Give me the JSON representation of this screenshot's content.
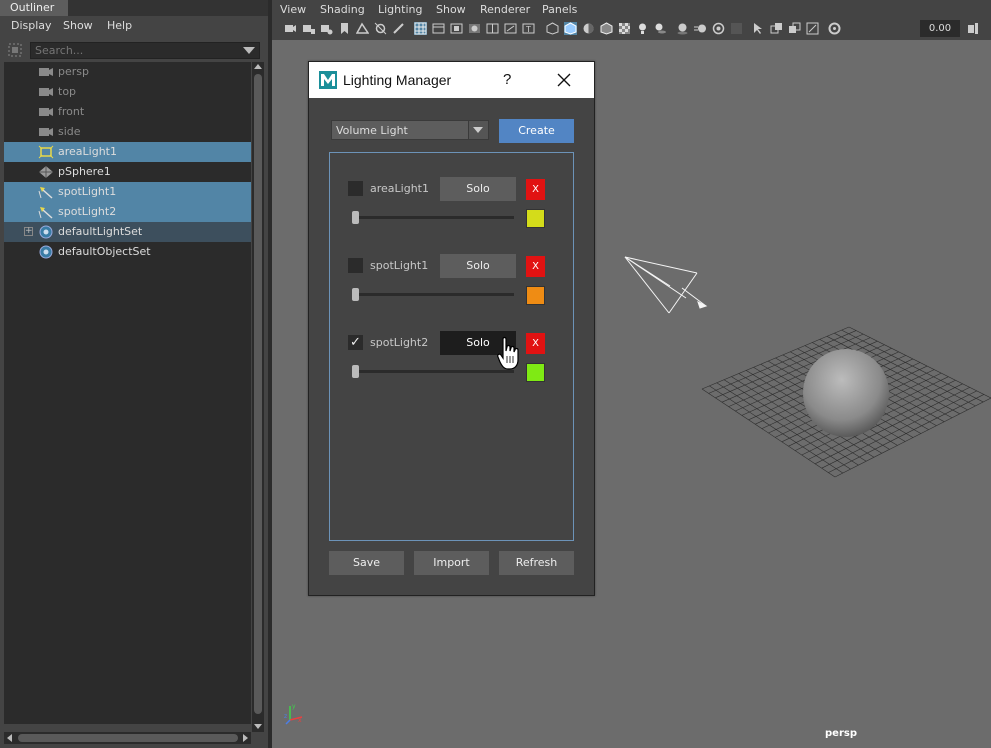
{
  "outliner": {
    "tab_label": "Outliner",
    "menu": [
      "Display",
      "Show",
      "Help"
    ],
    "search_placeholder": "Search...",
    "items": [
      {
        "label": "persp",
        "icon": "camera-icon",
        "state": "dim"
      },
      {
        "label": "top",
        "icon": "camera-icon",
        "state": "dim"
      },
      {
        "label": "front",
        "icon": "camera-icon",
        "state": "dim"
      },
      {
        "label": "side",
        "icon": "camera-icon",
        "state": "dim"
      },
      {
        "label": "areaLight1",
        "icon": "area-light-icon",
        "state": "selected"
      },
      {
        "label": "pSphere1",
        "icon": "mesh-icon",
        "state": "normal"
      },
      {
        "label": "spotLight1",
        "icon": "spot-light-icon",
        "state": "selected"
      },
      {
        "label": "spotLight2",
        "icon": "spot-light-icon",
        "state": "selected"
      },
      {
        "label": "defaultLightSet",
        "icon": "set-icon",
        "state": "highlight"
      },
      {
        "label": "defaultObjectSet",
        "icon": "set-icon",
        "state": "normal"
      }
    ]
  },
  "viewport": {
    "menu": [
      "View",
      "Shading",
      "Lighting",
      "Show",
      "Renderer",
      "Panels"
    ],
    "toolbar_value": "0.00",
    "camera_label": "persp"
  },
  "dialog": {
    "title": "Lighting Manager",
    "help_label": "?",
    "light_type_selected": "Volume Light",
    "create_label": "Create",
    "lights": [
      {
        "name": "areaLight1",
        "checked": false,
        "solo_label": "Solo",
        "solo_active": false,
        "delete_label": "X",
        "intensity": 0.0,
        "color": "#d4dc1a"
      },
      {
        "name": "spotLight1",
        "checked": false,
        "solo_label": "Solo",
        "solo_active": false,
        "delete_label": "X",
        "intensity": 0.0,
        "color": "#ef8c14"
      },
      {
        "name": "spotLight2",
        "checked": true,
        "solo_label": "Solo",
        "solo_active": true,
        "delete_label": "X",
        "intensity": 0.0,
        "color": "#7fea14"
      }
    ],
    "buttons": {
      "save": "Save",
      "import": "Import",
      "refresh": "Refresh"
    }
  }
}
